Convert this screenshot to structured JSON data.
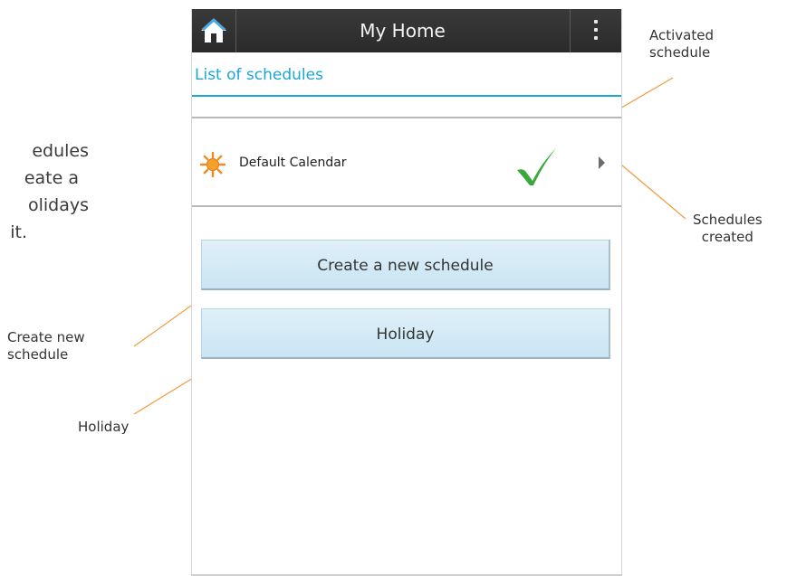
{
  "intro_text": {
    "line1": "edules",
    "line2": "eate a",
    "line3": "olidays",
    "line4": "it."
  },
  "callouts": {
    "activated_line1": "Activated",
    "activated_line2": "schedule",
    "created_line1": "Schedules",
    "created_line2": "created",
    "create_line1": "Create new",
    "create_line2": "schedule",
    "holiday": "Holiday"
  },
  "app": {
    "title": "My Home",
    "section_title": "List of schedules",
    "schedules": [
      {
        "name": "Default Calendar",
        "active": true,
        "icon": "sun-icon"
      }
    ],
    "create_button_label": "Create a new schedule",
    "holiday_button_label": "Holiday"
  },
  "colors": {
    "accent": "#1aa6d6",
    "callout_line": "#f39a3c",
    "check": "#3aa83a",
    "sun": "#f08a1c",
    "topbar": "#333333",
    "button_bg": "#d4ebf6"
  }
}
